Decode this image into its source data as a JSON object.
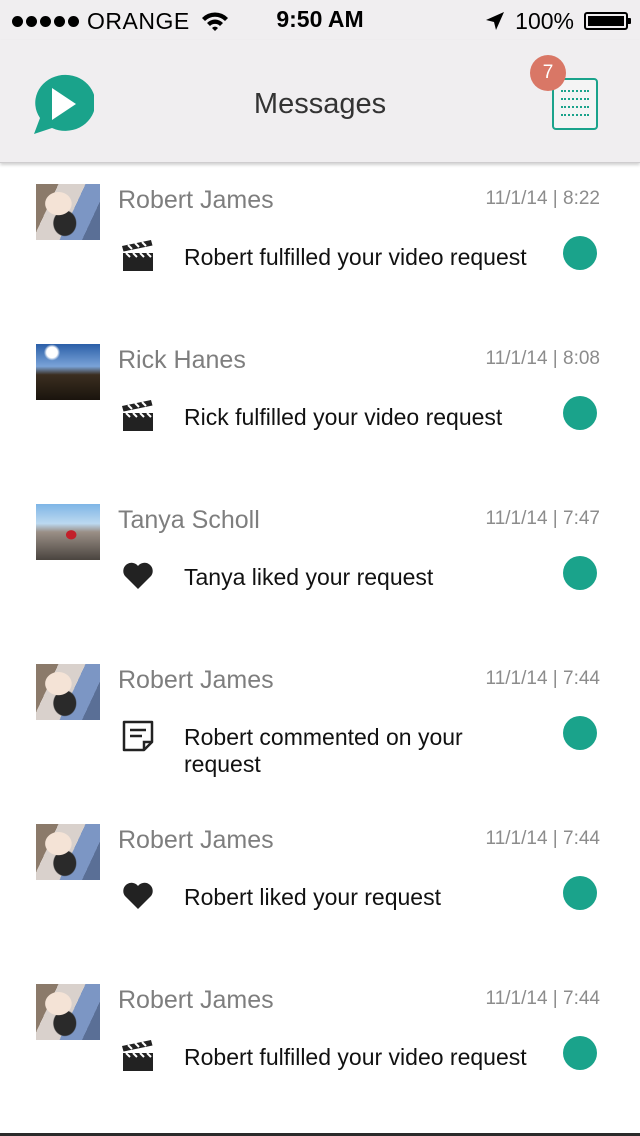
{
  "status_bar": {
    "carrier": "ORANGE",
    "time": "9:50 AM",
    "battery": "100%"
  },
  "header": {
    "title": "Messages",
    "badge_count": "7",
    "accent_color": "#1aa38b",
    "badge_color": "#d97766"
  },
  "messages": [
    {
      "name": "Robert James",
      "timestamp": "11/1/14 | 8:22",
      "text": "Robert fulfilled your video request",
      "icon": "clapperboard-icon",
      "avatar": "robert"
    },
    {
      "name": "Rick Hanes",
      "timestamp": "11/1/14 | 8:08",
      "text": "Rick fulfilled your video request",
      "icon": "clapperboard-icon",
      "avatar": "rick"
    },
    {
      "name": "Tanya Scholl",
      "timestamp": "11/1/14 | 7:47",
      "text": "Tanya liked your request",
      "icon": "heart-icon",
      "avatar": "tanya"
    },
    {
      "name": "Robert James",
      "timestamp": "11/1/14 | 7:44",
      "text": "Robert commented on your request",
      "icon": "comment-icon",
      "avatar": "robert"
    },
    {
      "name": "Robert James",
      "timestamp": "11/1/14 | 7:44",
      "text": "Robert liked your request",
      "icon": "heart-icon",
      "avatar": "robert"
    },
    {
      "name": "Robert James",
      "timestamp": "11/1/14 | 7:44",
      "text": "Robert fulfilled your video request",
      "icon": "clapperboard-icon",
      "avatar": "robert"
    }
  ]
}
